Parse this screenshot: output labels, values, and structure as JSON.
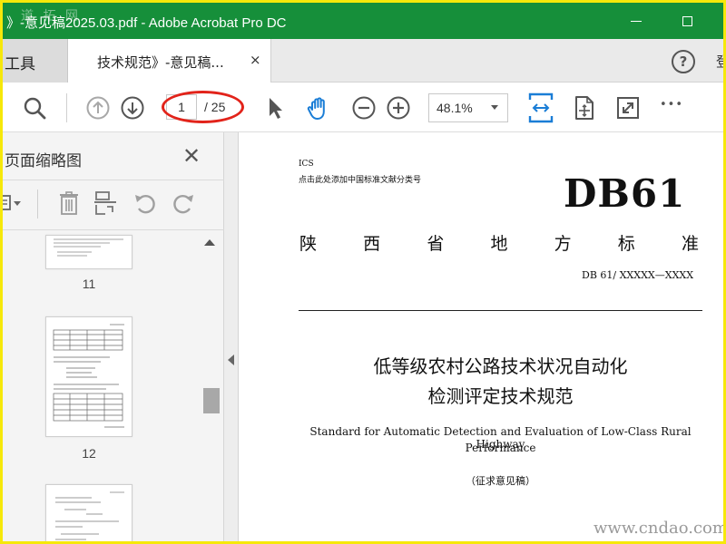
{
  "window": {
    "title": "》-意见稿2025.03.pdf - Adobe Acrobat Pro DC",
    "watermark_top": "道 拓 网"
  },
  "tabs": {
    "tools_label": "工具",
    "doc_tab_label": "技术规范》-意见稿...",
    "close_glyph": "×",
    "help_glyph": "?",
    "right_clip": "登"
  },
  "toolbar": {
    "page_current": "1",
    "page_total": "/ 25",
    "zoom_value": "48.1%",
    "more_glyph": "•••"
  },
  "left_panel": {
    "title": "页面缩略图",
    "close_glyph": "✕",
    "thumbnails": [
      {
        "number": "11"
      },
      {
        "number": "12"
      }
    ]
  },
  "document": {
    "ics": "ICS",
    "add_number_hint": "点击此处添加中国标准文献分类号",
    "std_prefix": "DB61",
    "province_chars": [
      "陕",
      "西",
      "省",
      "地",
      "方",
      "标",
      "准"
    ],
    "std_code": "DB 61/  XXXXX—XXXX",
    "title_line1": "低等级农村公路技术状况自动化",
    "title_line2": "检测评定技术规范",
    "english_line1": "Standard for Automatic Detection and Evaluation of Low-Class Rural Highway",
    "english_line2": "Performance",
    "draft_note": "（征求意见稿）",
    "watermark_bottom": "www.cndao.com"
  },
  "colors": {
    "title_bar": "#168f3a",
    "border": "#f6e80a",
    "accent_blue": "#1a7dd6",
    "highlight_oval": "#e2231a"
  },
  "icons": [
    "search-icon",
    "prev-page-icon",
    "next-page-icon",
    "select-cursor-icon",
    "hand-tool-icon",
    "zoom-out-icon",
    "zoom-in-icon",
    "fit-width-icon",
    "rotate-page-icon",
    "full-screen-icon",
    "more-icon"
  ]
}
